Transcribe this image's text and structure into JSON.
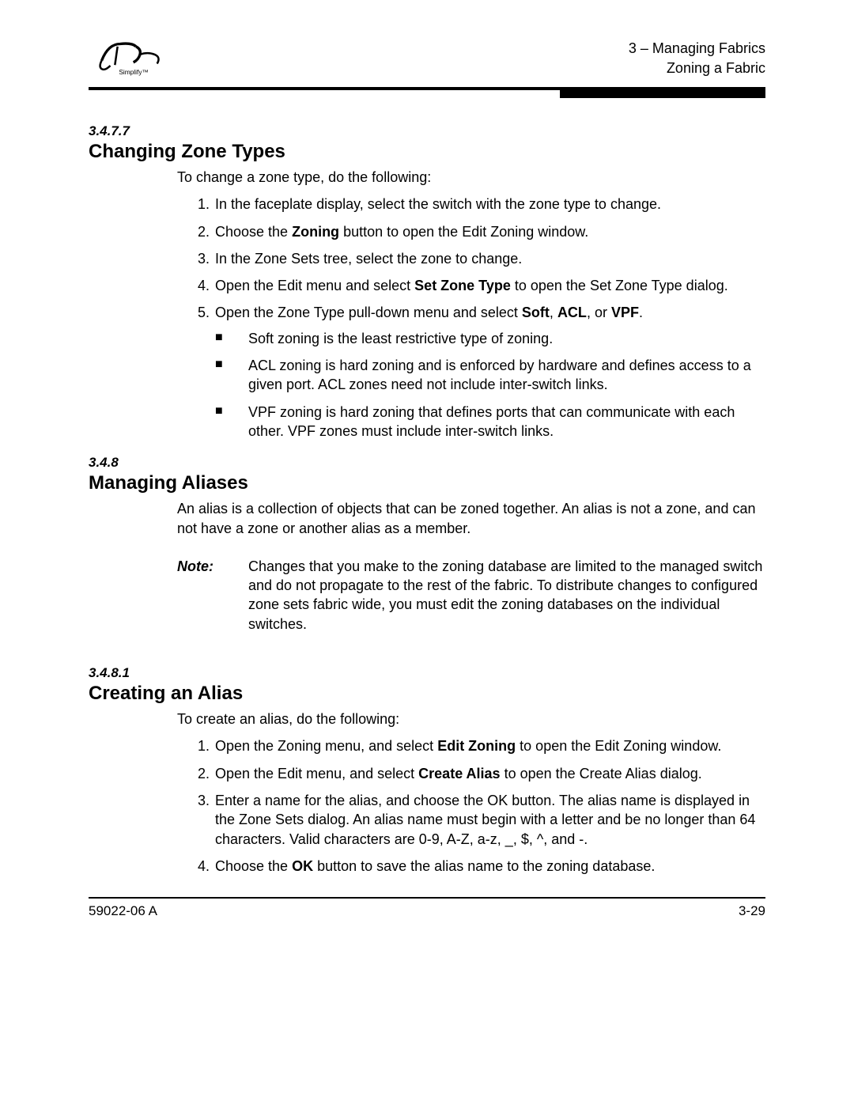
{
  "header": {
    "chapter_line": "3 – Managing Fabrics",
    "subline": "Zoning a Fabric",
    "logo_tagline": "Simplify™"
  },
  "section1": {
    "num": "3.4.7.7",
    "title": "Changing Zone Types",
    "intro": "To change a zone type, do the following:",
    "step1": "In the faceplate display, select the switch with the zone type to change.",
    "step2_a": "Choose the ",
    "step2_b": "Zoning",
    "step2_c": " button to open the Edit Zoning window.",
    "step3": "In the Zone Sets tree, select the zone to change.",
    "step4_a": "Open the Edit menu and select ",
    "step4_b": "Set Zone Type",
    "step4_c": " to open the Set Zone Type dialog.",
    "step5_a": "Open the Zone Type pull-down menu and select ",
    "step5_b": "Soft",
    "step5_c": ", ",
    "step5_d": "ACL",
    "step5_e": ", or ",
    "step5_f": "VPF",
    "step5_g": ".",
    "bullet1": "Soft zoning is the least restrictive type of zoning.",
    "bullet2": "ACL zoning is hard zoning and is enforced by hardware and defines access to a given port. ACL zones need not include inter-switch links.",
    "bullet3": "VPF zoning is hard zoning that defines ports that can communicate with each other. VPF zones must include inter-switch links."
  },
  "section2": {
    "num": "3.4.8",
    "title": "Managing Aliases",
    "intro": "An alias is a collection of objects that can be zoned together. An alias is not a zone, and can not have a zone or another alias as a member.",
    "note_label": "Note:",
    "note_text": "Changes that you make to the zoning database are limited to the managed switch and do not propagate to the rest of the fabric. To distribute changes to configured zone sets fabric wide, you must edit the zoning databases on the individual switches."
  },
  "section3": {
    "num": "3.4.8.1",
    "title": "Creating an Alias",
    "intro": "To create an alias, do the following:",
    "step1_a": "Open the Zoning menu, and select ",
    "step1_b": "Edit Zoning",
    "step1_c": " to open the Edit Zoning window.",
    "step2_a": "Open the Edit menu, and select ",
    "step2_b": "Create Alias",
    "step2_c": " to open the Create Alias dialog.",
    "step3": "Enter a name for the alias, and choose the OK button. The alias name is displayed in the Zone Sets dialog. An alias name must begin with a letter and be no longer than 64 characters. Valid characters are 0-9, A-Z, a-z, _, $, ^, and -.",
    "step4_a": "Choose the ",
    "step4_b": "OK",
    "step4_c": " button to save the alias name to the zoning database."
  },
  "footer": {
    "left": "59022-06 A",
    "right": "3-29"
  }
}
